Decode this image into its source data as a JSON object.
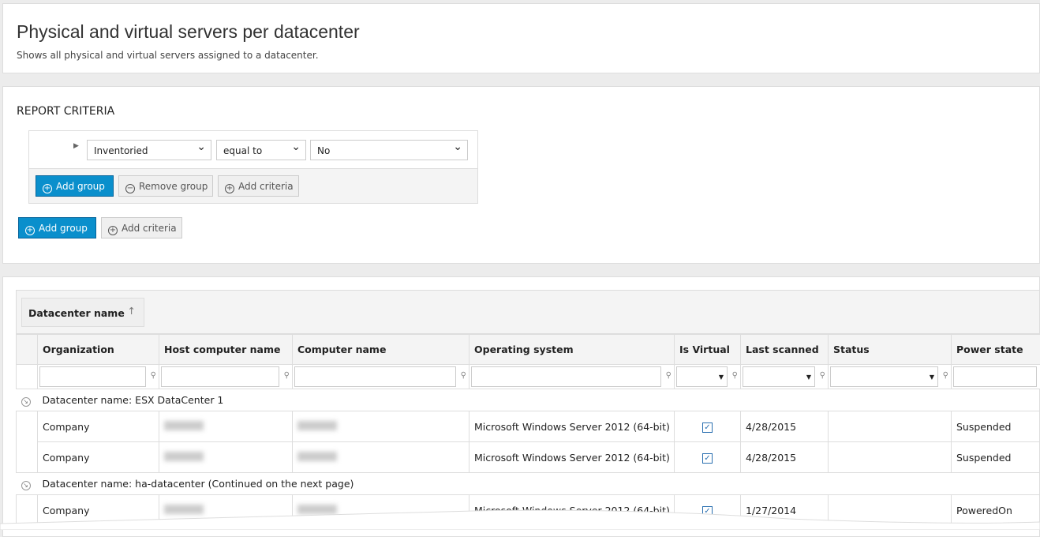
{
  "header": {
    "title": "Physical and virtual servers per datacenter",
    "subtitle": "Shows all physical and virtual servers assigned to a datacenter."
  },
  "criteria": {
    "title": "REPORT CRITERIA",
    "field": "Inventoried",
    "operator": "equal to",
    "value": "No",
    "add_group": "Add group",
    "remove_group": "Remove group",
    "add_criteria": "Add criteria"
  },
  "grouping": {
    "chip": "Datacenter name",
    "sort_icon": "arrow-up-icon"
  },
  "table": {
    "columns": [
      "Organization",
      "Host computer name",
      "Computer name",
      "Operating system",
      "Is Virtual",
      "Last scanned",
      "Status",
      "Power state"
    ],
    "groups": [
      {
        "label": "Datacenter name: ESX DataCenter 1",
        "rows": [
          {
            "org": "Company",
            "os": "Microsoft Windows Server 2012 (64-bit)",
            "virtual": true,
            "scanned": "4/28/2015",
            "status": "",
            "power": "Suspended"
          },
          {
            "org": "Company",
            "os": "Microsoft Windows Server 2012 (64-bit)",
            "virtual": true,
            "scanned": "4/28/2015",
            "status": "",
            "power": "Suspended"
          }
        ]
      },
      {
        "label": "Datacenter name: ha-datacenter (Continued on the next page)",
        "rows": [
          {
            "org": "Company",
            "os": "Microsoft Windows Server 2012 (64-bit)",
            "virtual": true,
            "scanned": "1/27/2014",
            "status": "",
            "power": "PoweredOn"
          }
        ]
      }
    ]
  },
  "colors": {
    "primary_button": "#0a8fcc",
    "checkbox": "#2a6fb0"
  }
}
